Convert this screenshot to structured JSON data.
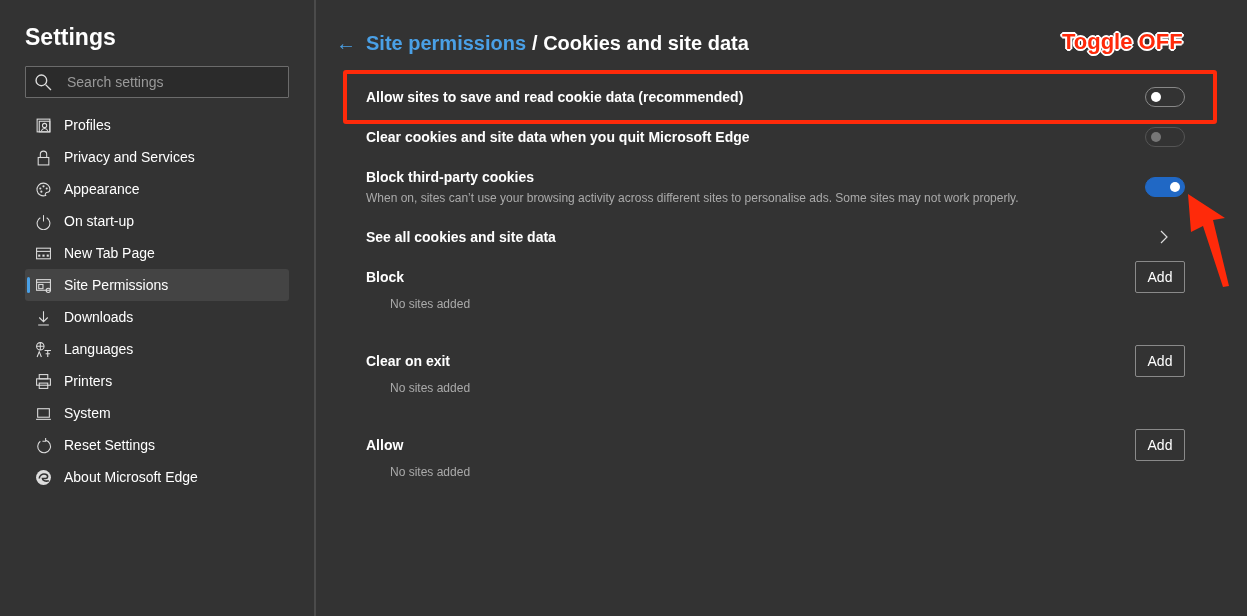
{
  "sidebar": {
    "title": "Settings",
    "search": {
      "placeholder": "Search settings"
    },
    "items": [
      {
        "label": "Profiles",
        "selected": false
      },
      {
        "label": "Privacy and Services",
        "selected": false
      },
      {
        "label": "Appearance",
        "selected": false
      },
      {
        "label": "On start-up",
        "selected": false
      },
      {
        "label": "New Tab Page",
        "selected": false
      },
      {
        "label": "Site Permissions",
        "selected": true
      },
      {
        "label": "Downloads",
        "selected": false
      },
      {
        "label": "Languages",
        "selected": false
      },
      {
        "label": "Printers",
        "selected": false
      },
      {
        "label": "System",
        "selected": false
      },
      {
        "label": "Reset Settings",
        "selected": false
      },
      {
        "label": "About Microsoft Edge",
        "selected": false
      }
    ]
  },
  "breadcrumb": {
    "back": "←",
    "link": "Site permissions",
    "current": "/ Cookies and site data"
  },
  "settings": [
    {
      "kind": "toggle",
      "label": "Allow sites to save and read cookie data (recommended)",
      "on": false,
      "disabled": false
    },
    {
      "kind": "toggle",
      "label": "Clear cookies and site data when you quit Microsoft Edge",
      "on": false,
      "disabled": true
    },
    {
      "kind": "toggle",
      "label": "Block third-party cookies",
      "description": "When on, sites can’t use your browsing activity across different sites to personalise ads. Some sites may not work properly.",
      "on": true,
      "disabled": false
    },
    {
      "kind": "link",
      "label": "See all cookies and site data"
    }
  ],
  "site_lists": [
    {
      "title": "Block",
      "button": "Add",
      "empty": "No sites added"
    },
    {
      "title": "Clear on exit",
      "button": "Add",
      "empty": "No sites added"
    },
    {
      "title": "Allow",
      "button": "Add",
      "empty": "No sites added"
    }
  ],
  "annotation": {
    "text": "Toggle OFF"
  }
}
